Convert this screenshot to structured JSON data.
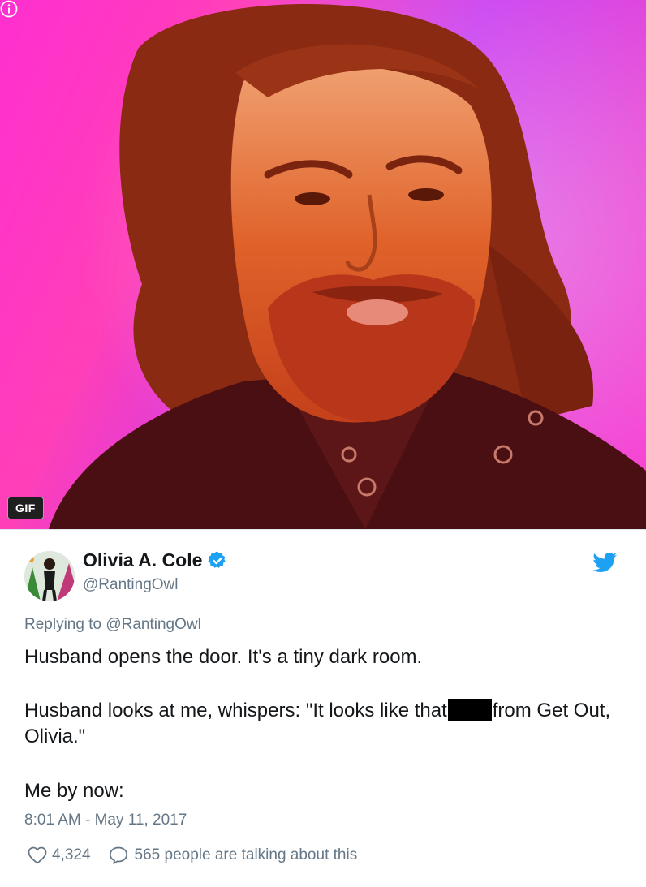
{
  "media": {
    "badge": "GIF",
    "info_icon": "info-icon",
    "colors": {
      "magenta": "#ff2fd0",
      "violet": "#c83cf0",
      "skin": "#e0622a",
      "hair": "#8a2a12",
      "jacket": "#4a0f12"
    }
  },
  "tweet": {
    "author_name": "Olivia A. Cole",
    "handle": "@RantingOwl",
    "verified_icon": "verified-badge-icon",
    "brand_icon": "twitter-bird-icon",
    "reply_prefix": "Replying to @RantingOwl",
    "line1": "Husband opens the door. It's a tiny dark room.",
    "line2_before": "Husband looks at me, whispers: \"It looks like that",
    "line2_after": "from Get Out, Olivia.\"",
    "line3": "Me by now:",
    "timestamp": "8:01 AM - May 11, 2017",
    "likes": "4,324",
    "talking": "565 people are talking about this",
    "accent": "#1da1f2"
  }
}
